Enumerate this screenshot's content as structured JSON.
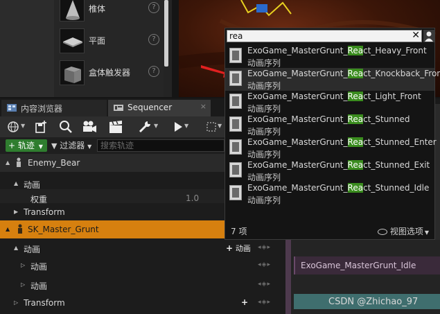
{
  "place_actors": {
    "items": [
      {
        "label": "椎体",
        "icon": "cone-icon"
      },
      {
        "label": "平面",
        "icon": "plane-icon"
      },
      {
        "label": "盒体触发器",
        "icon": "box-trigger-icon"
      }
    ],
    "help_glyph": "?"
  },
  "tabs": [
    {
      "label": "内容浏览器",
      "icon": "content-browser-icon",
      "active": false
    },
    {
      "label": "Sequencer",
      "icon": "sequencer-icon",
      "active": true
    }
  ],
  "tab_close_glyph": "×",
  "toolbar": {
    "buttons": [
      "globe-icon",
      "save-icon",
      "search-icon",
      "camera-icon",
      "clapperboard-icon",
      "wrench-icon",
      "play-icon",
      "selection-icon"
    ]
  },
  "filterbar": {
    "add_track_label": "+ 轨迹",
    "filter_label": "过滤器",
    "search_placeholder": "搜索轨迹"
  },
  "tracks": [
    {
      "label": "Enemy_Bear",
      "depth": 0,
      "expanded": true,
      "kind": "actor"
    },
    {
      "label": "动画",
      "depth": 1,
      "expanded": true,
      "kind": "section"
    },
    {
      "label": "权重",
      "depth": 2,
      "kind": "property",
      "value": "1.0"
    },
    {
      "label": "Transform",
      "depth": 1,
      "expanded": false,
      "kind": "section"
    },
    {
      "label": "SK_Master_Grunt",
      "depth": 0,
      "expanded": true,
      "kind": "actor",
      "selected": true
    },
    {
      "label": "动画",
      "depth": 1,
      "expanded": true,
      "kind": "section",
      "add_label": "动画"
    },
    {
      "label": "动画",
      "depth": 2,
      "expanded": false,
      "kind": "subtrack"
    },
    {
      "label": "动画",
      "depth": 2,
      "expanded": false,
      "kind": "subtrack"
    },
    {
      "label": "Transform",
      "depth": 1,
      "expanded": false,
      "kind": "section",
      "add_label": ""
    }
  ],
  "key_nav_glyphs": "◂◈▸",
  "timeline": {
    "clip_label": "ExoGame_MasterGrunt_Idle"
  },
  "popup": {
    "search_value": "rea",
    "clear_glyph": "✕",
    "results": [
      {
        "prefix": "ExoGame_MasterGrunt_",
        "match": "Rea",
        "suffix": "ct_Heavy_Front",
        "type": "动画序列"
      },
      {
        "prefix": "ExoGame_MasterGrunt_",
        "match": "Rea",
        "suffix": "ct_Knockback_Front",
        "type": "动画序列"
      },
      {
        "prefix": "ExoGame_MasterGrunt_",
        "match": "Rea",
        "suffix": "ct_Light_Front",
        "type": "动画序列"
      },
      {
        "prefix": "ExoGame_MasterGrunt_",
        "match": "Rea",
        "suffix": "ct_Stunned",
        "type": "动画序列"
      },
      {
        "prefix": "ExoGame_MasterGrunt_",
        "match": "Rea",
        "suffix": "ct_Stunned_Enter",
        "type": "动画序列"
      },
      {
        "prefix": "ExoGame_MasterGrunt_",
        "match": "Rea",
        "suffix": "ct_Stunned_Exit",
        "type": "动画序列"
      },
      {
        "prefix": "ExoGame_MasterGrunt_",
        "match": "Rea",
        "suffix": "ct_Stunned_Idle",
        "type": "动画序列"
      }
    ],
    "count_label": "7 项",
    "view_options_label": "视图选项"
  },
  "watermark": "CSDN @Zhichao_97",
  "colors": {
    "selected_track": "#d6800f",
    "add_track_green": "#2f7d2f",
    "match_highlight": "#3a8c1e",
    "annotation_arrow": "#e02020"
  }
}
